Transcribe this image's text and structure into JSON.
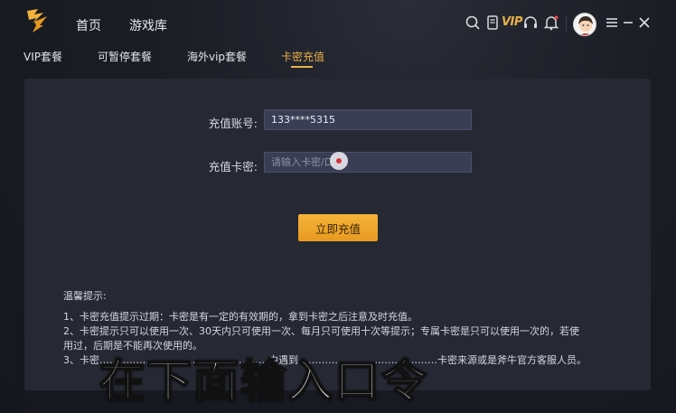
{
  "nav": {
    "home": "首页",
    "games": "游戏库"
  },
  "toolbar": {
    "vip_label": "VIP"
  },
  "tabs": [
    {
      "label": "VIP套餐",
      "active": false
    },
    {
      "label": "可暂停套餐",
      "active": false
    },
    {
      "label": "海外vip套餐",
      "active": false
    },
    {
      "label": "卡密充值",
      "active": true
    }
  ],
  "form": {
    "account_label": "充值账号:",
    "account_value": "133****5315",
    "code_label": "充值卡密:",
    "code_placeholder": "请输入卡密/口令",
    "submit_label": "立即充值"
  },
  "tips": {
    "title": "温馨提示:",
    "lines": [
      "1、卡密充值提示过期：卡密是有一定的有效期的，拿到卡密之后注意及时充值。",
      "2、卡密提示只可以使用一次、30天内只可使用一次、每月只可使用十次等提示；专属卡密是只可以使用一次的，若使",
      "用过，后期是不能再次使用的。",
      "3、卡密……………………………………………中遇到……………………………………卡密来源或是斧牛官方客服人员。"
    ]
  },
  "caption": "在下面输入口令",
  "colors": {
    "accent": "#e9b04a",
    "panel": "#262933",
    "input_bg": "#3a3e55"
  }
}
